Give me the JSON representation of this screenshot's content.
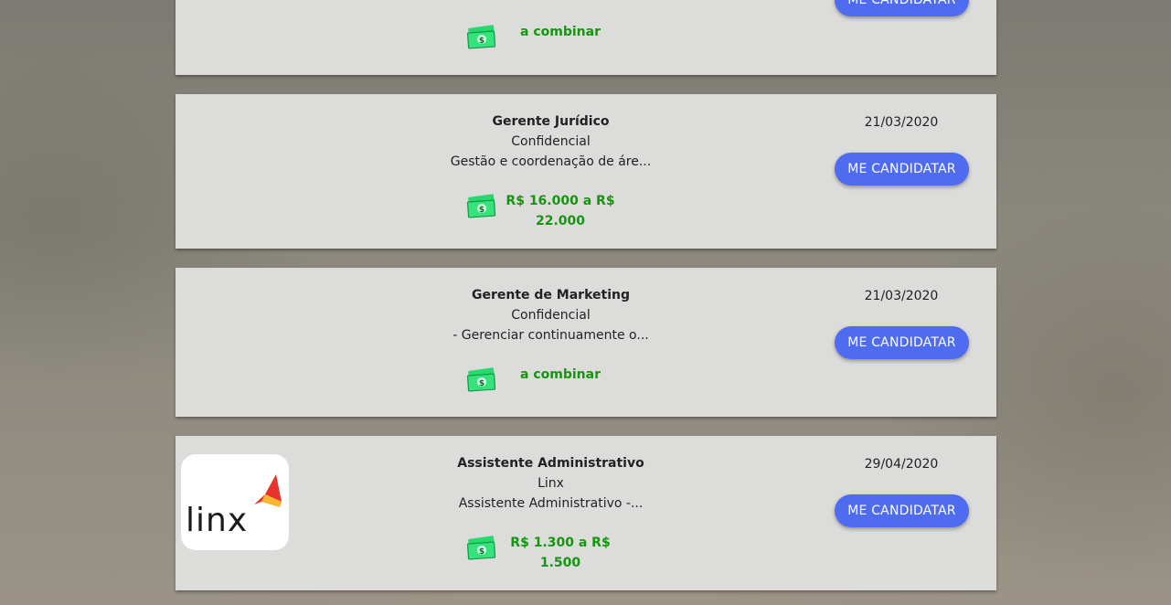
{
  "jobs": [
    {
      "title": "",
      "company": "",
      "description": "",
      "salary_line1": "a combinar",
      "salary_line2": "",
      "date": "",
      "apply_label": "ME CANDIDATAR",
      "logo": null
    },
    {
      "title": "Gerente Jurídico",
      "company": "Confidencial",
      "description": "Gestão e coordenação de áre...",
      "salary_line1": "R$ 16.000 a R$",
      "salary_line2": "22.000",
      "date": "21/03/2020",
      "apply_label": "ME CANDIDATAR",
      "logo": null
    },
    {
      "title": "Gerente de Marketing",
      "company": "Confidencial",
      "description": "- Gerenciar continuamente o...",
      "salary_line1": "a combinar",
      "salary_line2": "",
      "date": "21/03/2020",
      "apply_label": "ME CANDIDATAR",
      "logo": null
    },
    {
      "title": "Assistente Administrativo",
      "company": "Linx",
      "description": "Assistente Administrativo -...",
      "salary_line1": "R$ 1.300 a R$",
      "salary_line2": "1.500",
      "date": "29/04/2020",
      "apply_label": "ME CANDIDATAR",
      "logo": {
        "text": "linx",
        "accent_colors": [
          "#f5a623",
          "#e8322b"
        ]
      }
    }
  ],
  "icons": {
    "salary": "money-bill-icon"
  },
  "colors": {
    "card_bg": "#dcdcdb",
    "button": "#4f6cf1",
    "salary_text": "#15960f"
  }
}
